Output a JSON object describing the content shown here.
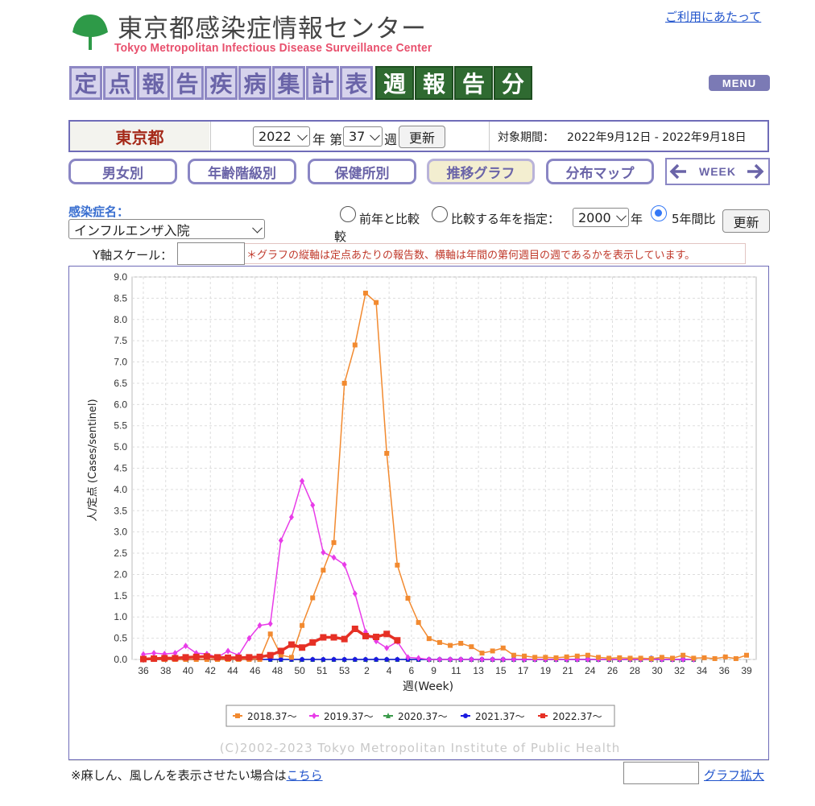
{
  "header": {
    "title": "東京都感染症情報センター",
    "subtitle": "Tokyo Metropolitan Infectious Disease Surveillance Center",
    "terms_link": "ご利用にあたって",
    "logo_icon": "ginkgo-leaf-icon",
    "tiles_light": [
      "定",
      "点",
      "報",
      "告",
      "疾",
      "病",
      "集",
      "計",
      "表"
    ],
    "tiles_dark": [
      "週",
      "報",
      "告",
      "分"
    ],
    "menu_label": "MENU",
    "colors": {
      "tile_light": "#d6d3ec",
      "tile_dark": "#2f6a31",
      "brand_pink": "#e8506d"
    }
  },
  "controls": {
    "region": "東京都",
    "year_value": "2022",
    "year_suffix": "年 第",
    "week_value": "37",
    "week_suffix": "週",
    "update_label": "更新",
    "period_label": "対象期間：",
    "period_value": "2022年9月12日 - 2022年9月18日"
  },
  "tabs": [
    {
      "label": "男女別",
      "active": false
    },
    {
      "label": "年齢階級別",
      "active": false
    },
    {
      "label": "保健所別",
      "active": false
    },
    {
      "label": "推移グラフ",
      "active": true
    },
    {
      "label": "分布マップ",
      "active": false
    }
  ],
  "week_nav": {
    "label": "WEEK",
    "prev_icon": "arrow-left-icon",
    "next_icon": "arrow-right-icon"
  },
  "disease": {
    "label": "感染症名：",
    "selected": "インフルエンザ入院"
  },
  "compare": {
    "option1": "前年と比較",
    "option1_wrap": "較",
    "option2": "比較する年を指定：",
    "year_value": "2000",
    "year_suffix": "年",
    "option3": "5年間比",
    "selected_option": 3,
    "update_label": "更新"
  },
  "scale": {
    "label": "Y軸スケール：",
    "value": "",
    "note": "＊グラフの縦軸は定点あたりの報告数、横軸は年間の第何週目の週であるかを表示しています。"
  },
  "chart_data": {
    "type": "line",
    "xlabel": "週(Week)",
    "ylabel": "人/定点 (Cases/sentinel)",
    "ylim": [
      0,
      9.0
    ],
    "y_ticks": [
      "0.0",
      "0.5",
      "1.0",
      "1.5",
      "2.0",
      "2.5",
      "3.0",
      "3.5",
      "4.0",
      "4.5",
      "5.0",
      "5.5",
      "6.0",
      "6.5",
      "7.0",
      "7.5",
      "8.0",
      "8.5",
      "9.0"
    ],
    "x_tick_labels": [
      "36",
      "38",
      "40",
      "42",
      "44",
      "46",
      "48",
      "50",
      "51",
      "53",
      "2",
      "4",
      "6",
      "9",
      "11",
      "13",
      "15",
      "17",
      "19",
      "21",
      "24",
      "26",
      "28",
      "30",
      "32",
      "34",
      "36",
      "39"
    ],
    "grid": true,
    "legend_position": "bottom",
    "copyright": "(C)2002-2023 Tokyo Metropolitan Institute of Public Health",
    "series": [
      {
        "name": "2018.37～",
        "color": "#f28a30",
        "marker": "square",
        "values": [
          0.0,
          0.0,
          0.0,
          0.0,
          0.0,
          0.0,
          0.0,
          0.0,
          0.0,
          0.0,
          0.0,
          0.0,
          0.6,
          0.1,
          0.05,
          0.8,
          1.45,
          2.1,
          2.75,
          6.5,
          7.4,
          8.62,
          8.4,
          4.85,
          2.22,
          1.44,
          0.87,
          0.49,
          0.4,
          0.33,
          0.38,
          0.3,
          0.15,
          0.2,
          0.27,
          0.1,
          0.08,
          0.05,
          0.05,
          0.04,
          0.06,
          0.08,
          0.1,
          0.05,
          0.03,
          0.04,
          0.03,
          0.03,
          0.02,
          0.05,
          0.03,
          0.1,
          0.03,
          0.04,
          0.02,
          0.06,
          0.02,
          0.1
        ]
      },
      {
        "name": "2019.37～",
        "color": "#e83ce8",
        "marker": "diamond",
        "values": [
          0.12,
          0.15,
          0.13,
          0.15,
          0.32,
          0.15,
          0.13,
          0.05,
          0.2,
          0.1,
          0.5,
          0.8,
          0.84,
          2.8,
          3.35,
          4.2,
          3.63,
          2.52,
          2.4,
          2.23,
          1.55,
          0.65,
          0.43,
          0.27,
          0.42,
          0.05,
          0.03,
          0.0,
          0.0,
          0.0,
          0.0,
          0.0,
          0.0,
          0.0,
          0.0,
          0.0,
          0.0,
          0.0,
          0.0,
          0.0,
          0.0,
          0.0,
          0.0,
          0.0,
          0.0,
          0.0,
          0.0,
          0.0,
          0.0,
          0.0,
          0.0,
          0.0,
          0.0
        ]
      },
      {
        "name": "2020.37～",
        "color": "#3a9a4a",
        "marker": "triangle",
        "values": [
          0.0,
          0.0,
          0.0,
          0.0,
          0.0,
          0.0,
          0.0,
          0.0,
          0.0,
          0.0,
          0.0,
          0.0,
          0.0,
          0.0,
          0.0,
          0.0,
          0.0,
          0.0,
          0.0,
          0.0,
          0.0,
          0.0,
          0.0,
          0.0,
          0.0,
          0.0,
          0.0,
          0.0,
          0.0,
          0.0,
          0.0,
          0.0,
          0.0,
          0.0,
          0.0,
          0.0,
          0.0,
          0.0,
          0.0,
          0.0,
          0.0,
          0.0,
          0.0,
          0.0,
          0.0,
          0.0,
          0.0,
          0.0,
          0.0,
          0.0,
          0.0,
          0.0,
          0.0
        ]
      },
      {
        "name": "2021.37～",
        "color": "#1a1ae0",
        "marker": "circle",
        "values": [
          0.0,
          0.0,
          0.0,
          0.0,
          0.0,
          0.0,
          0.0,
          0.0,
          0.0,
          0.0,
          0.0,
          0.0,
          0.0,
          0.0,
          0.0,
          0.0,
          0.0,
          0.0,
          0.0,
          0.0,
          0.0,
          0.0,
          0.0,
          0.0,
          0.0,
          0.0,
          0.0,
          0.0,
          0.0,
          0.0,
          0.0,
          0.0,
          0.0,
          0.0,
          0.0,
          0.0,
          0.0,
          0.0,
          0.0,
          0.0,
          0.0,
          0.0,
          0.0,
          0.0,
          0.0,
          0.0,
          0.0,
          0.0,
          0.03,
          0.0,
          0.0,
          0.0,
          0.0
        ]
      },
      {
        "name": "2022.37～",
        "color": "#e63025",
        "marker": "square",
        "values": [
          0.01,
          0.02,
          0.03,
          0.03,
          0.05,
          0.06,
          0.07,
          0.05,
          0.04,
          0.04,
          0.05,
          0.06,
          0.1,
          0.2,
          0.35,
          0.28,
          0.4,
          0.52,
          0.52,
          0.48,
          0.72,
          0.55,
          0.53,
          0.6,
          0.45
        ]
      }
    ]
  },
  "footer": {
    "text": "※麻しん、風しんを表示させたい場合は",
    "link": "こちら",
    "zoom_link": "グラフ拡大"
  }
}
